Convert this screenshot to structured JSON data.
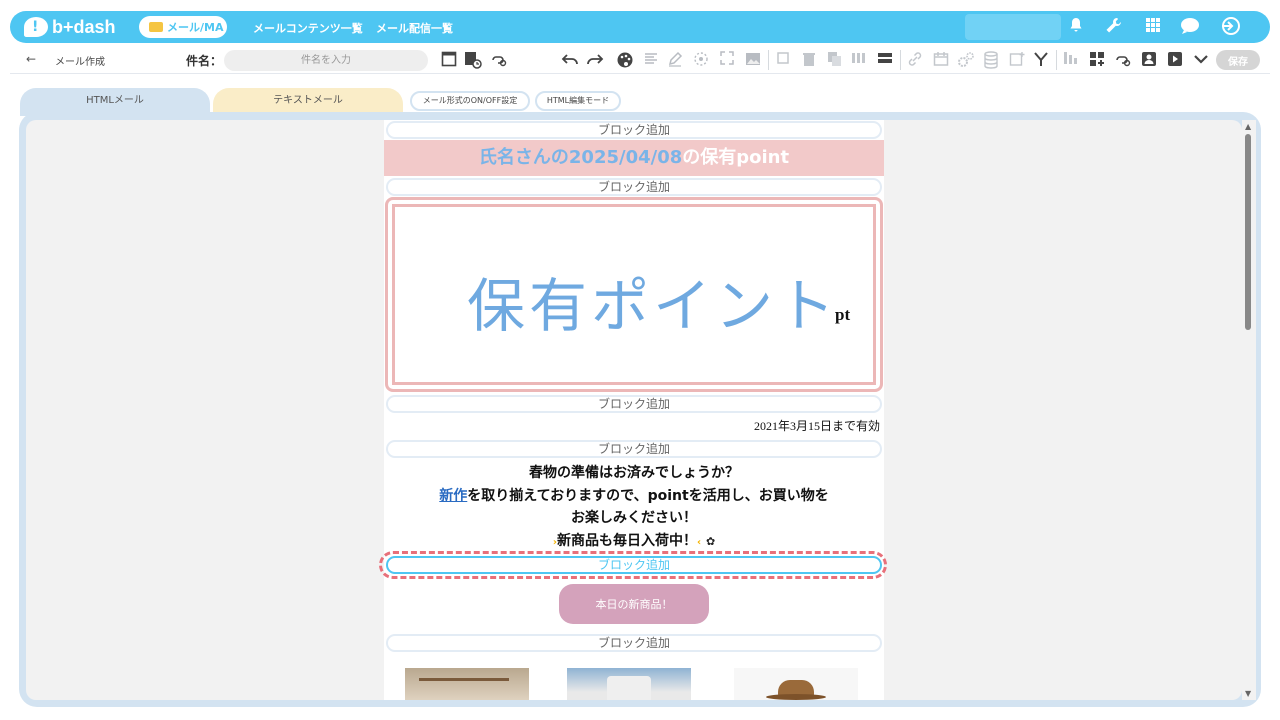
{
  "header": {
    "logo_text": "b+dash",
    "nav_active": "メール/MA",
    "nav_links": [
      "メールコンテンツ一覧",
      "メール配信一覧"
    ],
    "icons": [
      "bell-icon",
      "wrench-icon",
      "grid-icon",
      "chat-icon",
      "logout-icon"
    ]
  },
  "toolbar": {
    "back_symbol": "←",
    "page_title": "メール作成",
    "subject_label": "件名：",
    "subject_placeholder": "件名を入力",
    "save_label": "保存"
  },
  "tabs": {
    "html": "HTMLメール",
    "text": "テキストメール",
    "toggle_format": "メール形式のON/OFF設定",
    "html_edit_mode": "HTML編集モード"
  },
  "email": {
    "add_block_label": "ブロック追加",
    "title_prefix": "氏名さんの",
    "title_date": "2025/04/08",
    "title_suffix": "の保有point",
    "point_text": "保有ポイント",
    "point_unit": "pt",
    "expiry": "2021年3月15日まで有効",
    "line1": "春物の準備はお済みでしょうか？",
    "line2_link": "新作",
    "line2_rest": "を取り揃えておりますので、pointを活用し、お買い物を",
    "line3": "お楽しみください！",
    "line4": "新商品も毎日入荷中！",
    "cta_label": "本日の新商品！"
  },
  "colors": {
    "accent": "#4ec6f2",
    "title_band": "#f2c9c9",
    "point_text": "#6fa9e0",
    "cta": "#d4a2bb",
    "active_outline": "#e8707a"
  }
}
